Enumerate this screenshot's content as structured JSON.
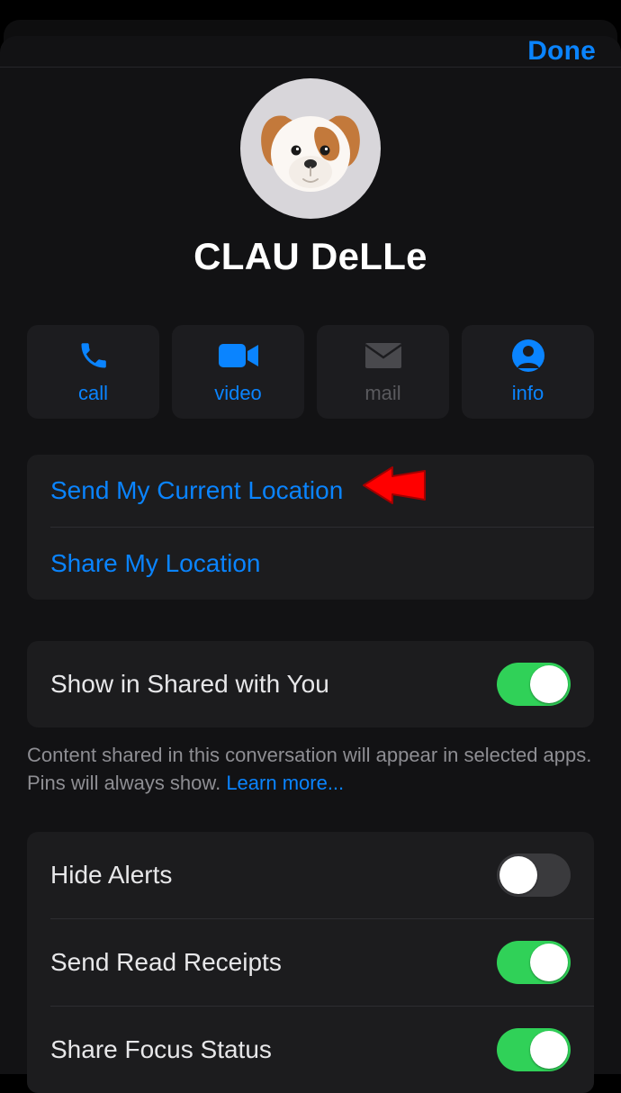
{
  "nav": {
    "done": "Done"
  },
  "contact": {
    "name": "CLAU DeLLe"
  },
  "actions": {
    "call": "call",
    "video": "video",
    "mail": "mail",
    "info": "info"
  },
  "location_group": {
    "send": "Send My Current Location",
    "share": "Share My Location"
  },
  "shared_section": {
    "label": "Show in Shared with You",
    "on": true,
    "footer_1": "Content shared in this conversation will appear in selected apps. Pins will always show. ",
    "learn": "Learn more..."
  },
  "alerts_group": {
    "hide_alerts": {
      "label": "Hide Alerts",
      "on": false
    },
    "read_receipts": {
      "label": "Send Read Receipts",
      "on": true
    },
    "focus_status": {
      "label": "Share Focus Status",
      "on": true
    }
  },
  "colors": {
    "accent": "#0a84ff",
    "toggle_on": "#30d158"
  }
}
